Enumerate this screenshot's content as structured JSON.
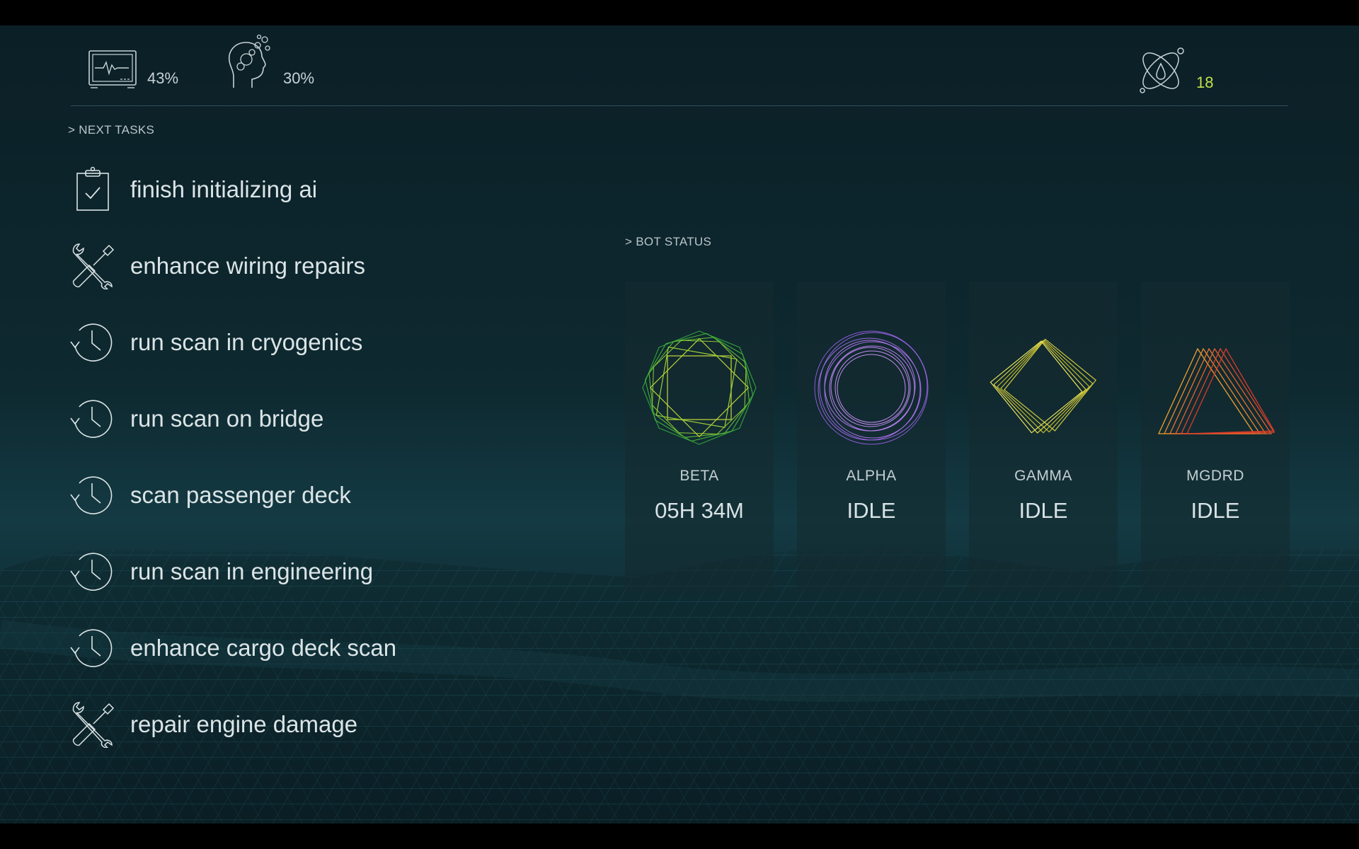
{
  "status_bar": {
    "vitals": {
      "icon": "heart-monitor-icon",
      "value": "43%"
    },
    "mind": {
      "icon": "brain-head-icon",
      "value": "30%"
    },
    "energy": {
      "icon": "atom-drop-icon",
      "value": "18",
      "color": "#c3e04a"
    }
  },
  "tasks": {
    "heading": "> NEXT TASKS",
    "items": [
      {
        "icon": "clipboard-check-icon",
        "label": "finish initializing ai"
      },
      {
        "icon": "wrench-screwdriver-icon",
        "label": "enhance wiring repairs"
      },
      {
        "icon": "clock-history-icon",
        "label": "run scan in cryogenics"
      },
      {
        "icon": "clock-history-icon",
        "label": "run scan on bridge"
      },
      {
        "icon": "clock-history-icon",
        "label": "scan passenger deck"
      },
      {
        "icon": "clock-history-icon",
        "label": "run scan in engineering"
      },
      {
        "icon": "clock-history-icon",
        "label": "enhance cargo deck scan"
      },
      {
        "icon": "wrench-screwdriver-icon",
        "label": "repair engine damage"
      }
    ]
  },
  "bots": {
    "heading": "> BOT STATUS",
    "items": [
      {
        "name": "BETA",
        "status": "05H 34M",
        "glyph": "octagon-spiral-icon",
        "colors": [
          "#2f9a3a",
          "#c7d93a"
        ]
      },
      {
        "name": "ALPHA",
        "status": "IDLE",
        "glyph": "ring-spiral-icon",
        "colors": [
          "#8a5bd6",
          "#c58cf0"
        ]
      },
      {
        "name": "GAMMA",
        "status": "IDLE",
        "glyph": "diamond-spiral-icon",
        "colors": [
          "#b8b42a",
          "#e9e25a"
        ]
      },
      {
        "name": "MGDRD",
        "status": "IDLE",
        "glyph": "triangle-spiral-icon",
        "colors": [
          "#e0452a",
          "#f0a030"
        ]
      }
    ]
  }
}
